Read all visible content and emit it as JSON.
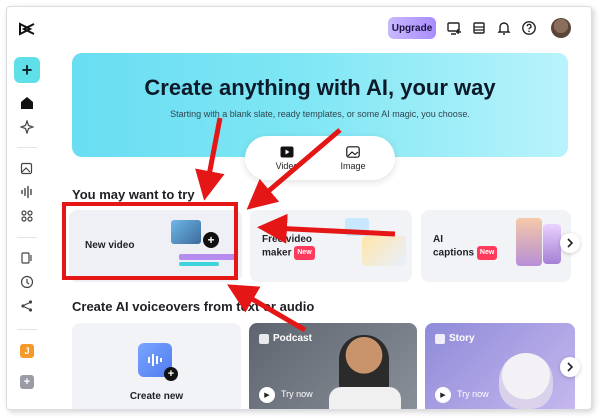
{
  "topbar": {
    "upgrade_label": "Upgrade"
  },
  "sidebar": {
    "create_label": "+",
    "workspace_initial": "J",
    "add_label": "+"
  },
  "hero": {
    "title": "Create anything with AI, your way",
    "subtitle": "Starting with a blank slate, ready templates, or some AI magic, you choose.",
    "tabs": [
      {
        "label": "Video",
        "icon": "play-icon"
      },
      {
        "label": "Image",
        "icon": "image-icon"
      }
    ]
  },
  "try_section": {
    "title": "You may want to try",
    "cards": [
      {
        "label": "New video"
      },
      {
        "label_line1": "Free video",
        "label_line2": "maker",
        "badge": "New"
      },
      {
        "label_line1": "AI",
        "label_line2": "captions",
        "badge": "New"
      }
    ]
  },
  "voiceover_section": {
    "title": "Create AI voiceovers from text or audio",
    "cards": [
      {
        "label": "Create new"
      },
      {
        "tag": "Podcast",
        "action": "Try now"
      },
      {
        "tag": "Story",
        "action": "Try now"
      }
    ]
  },
  "colors": {
    "accent_cyan": "#5fe0e8",
    "annotation_red": "#e41616",
    "new_badge": "#ff3a5c"
  }
}
